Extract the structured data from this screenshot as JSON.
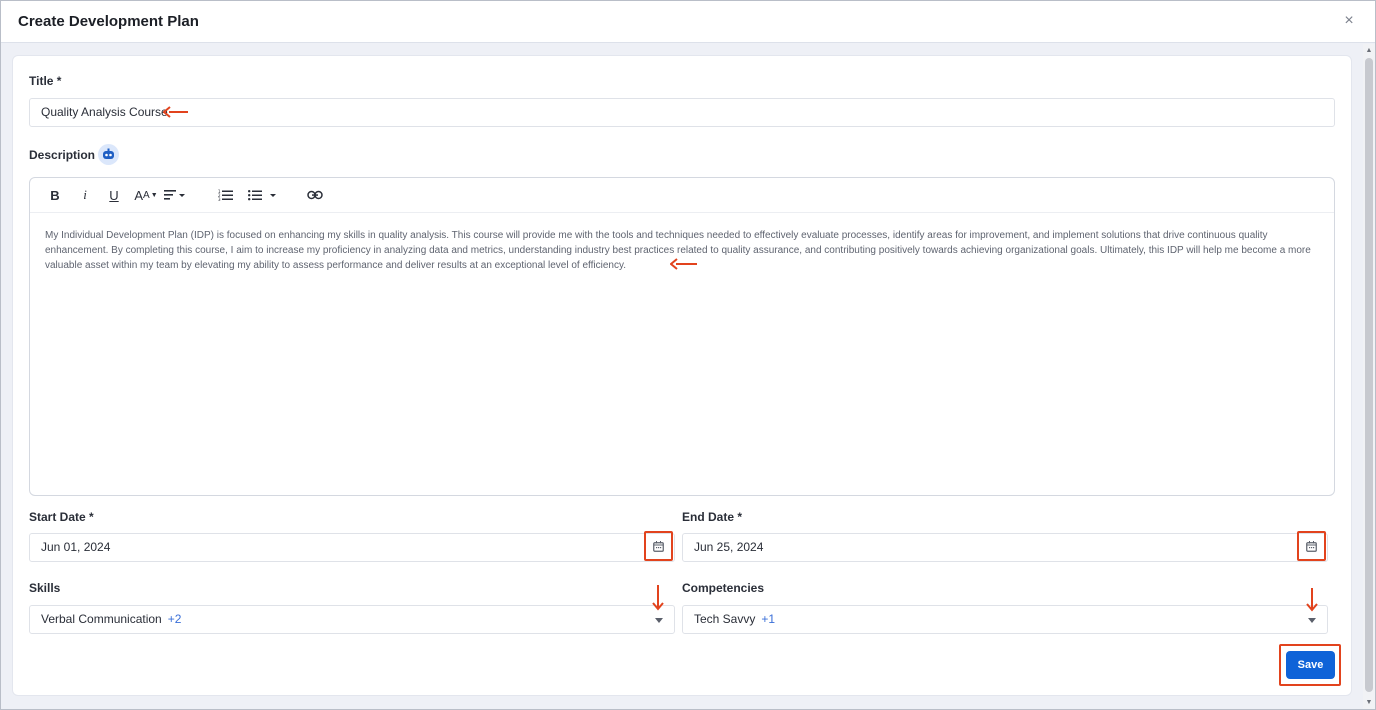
{
  "dialog": {
    "title": "Create Development Plan",
    "close_icon": "×"
  },
  "form": {
    "title_label": "Title",
    "title_required": "*",
    "title_value": "Quality Analysis Course",
    "description_label": "Description",
    "description_text": "My Individual Development Plan (IDP) is focused on enhancing my skills in quality analysis. This course will provide me with the tools and techniques needed to effectively evaluate processes, identify areas for improvement, and implement solutions that drive continuous quality enhancement. By completing this course, I aim to increase my proficiency in analyzing data and metrics, understanding industry best practices related to quality assurance, and contributing positively towards achieving organizational goals. Ultimately, this IDP will help me become a more valuable asset within my team by elevating my ability to assess performance and deliver results at an exceptional level of efficiency.",
    "start_date_label": "Start Date",
    "start_date_required": "*",
    "start_date_value": "Jun 01, 2024",
    "end_date_label": "End Date",
    "end_date_required": "*",
    "end_date_value": "Jun 25, 2024",
    "skills_label": "Skills",
    "skills_value": "Verbal Communication",
    "skills_more": "+2",
    "competencies_label": "Competencies",
    "competencies_value": "Tech Savvy",
    "competencies_more": "+1",
    "save_label": "Save"
  },
  "toolbar": {
    "bold": "B",
    "italic": "i",
    "underline": "U",
    "font_size": "AA"
  },
  "colors": {
    "accent": "#0f63d8",
    "annotation": "#e2431d",
    "more_count": "#3a6fd8"
  },
  "icons": [
    "close-icon",
    "ai-assistant-icon",
    "bold-icon",
    "italic-icon",
    "underline-icon",
    "font-size-icon",
    "align-icon",
    "ordered-list-icon",
    "bullet-list-icon",
    "link-icon",
    "calendar-icon",
    "chevron-down-icon"
  ]
}
